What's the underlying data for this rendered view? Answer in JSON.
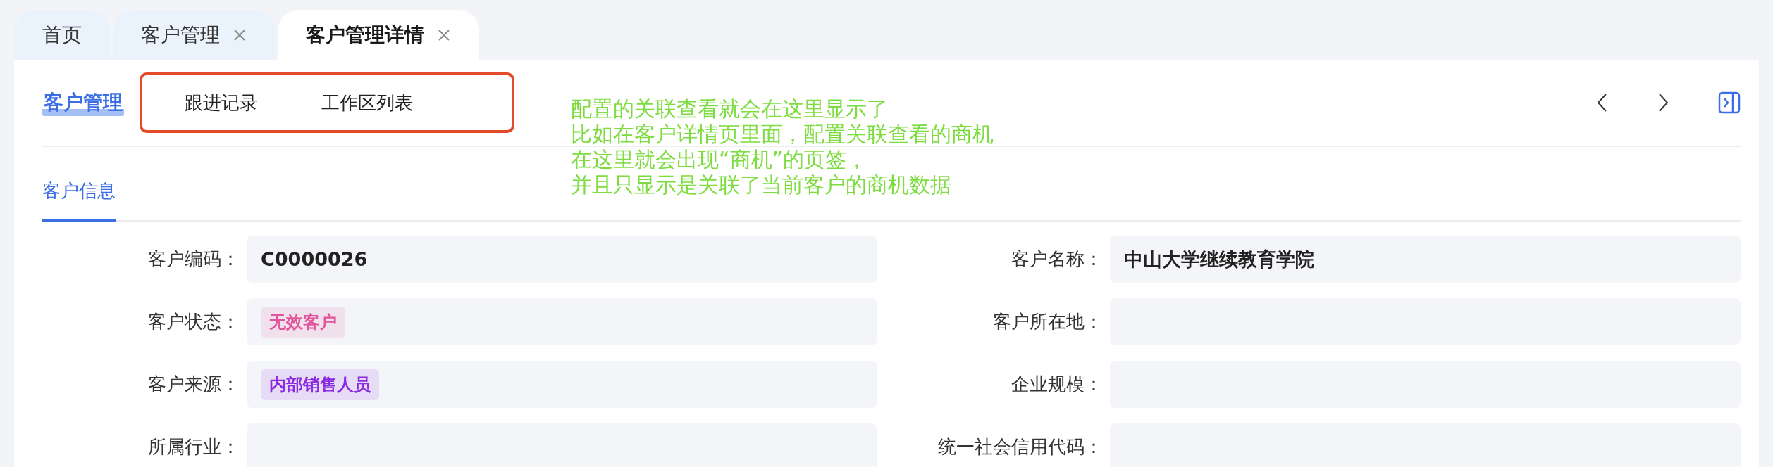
{
  "tabs": [
    {
      "label": "首页",
      "selected": false,
      "closable": false
    },
    {
      "label": "客户管理",
      "selected": false,
      "closable": true
    },
    {
      "label": "客户管理详情",
      "selected": true,
      "closable": true
    }
  ],
  "header": {
    "title": "客户管理",
    "related_tabs": [
      {
        "label": "跟进记录"
      },
      {
        "label": "工作区列表"
      }
    ]
  },
  "annotation": {
    "lines": [
      "配置的关联查看就会在这里显示了",
      "比如在客户详情页里面，配置关联查看的商机",
      "在这里就会出现“商机”的页签，",
      "并且只显示是关联了当前客户的商机数据"
    ]
  },
  "section_tabs": [
    {
      "label": "客户信息",
      "selected": true
    }
  ],
  "fields": [
    {
      "label": "客户编码：",
      "kind": "text",
      "value": "C0000026"
    },
    {
      "label": "客户名称：",
      "kind": "text",
      "value": "中山大学继续教育学院"
    },
    {
      "label": "客户状态：",
      "kind": "tag",
      "value": "无效客户",
      "color": "#e0559b"
    },
    {
      "label": "客户所在地：",
      "kind": "empty"
    },
    {
      "label": "客户来源：",
      "kind": "tag",
      "value": "内部销售人员",
      "color": "#8a2be2"
    },
    {
      "label": "企业规模：",
      "kind": "empty"
    },
    {
      "label": "所属行业：",
      "kind": "empty"
    },
    {
      "label": "统一社会信用代码：",
      "kind": "empty"
    }
  ]
}
